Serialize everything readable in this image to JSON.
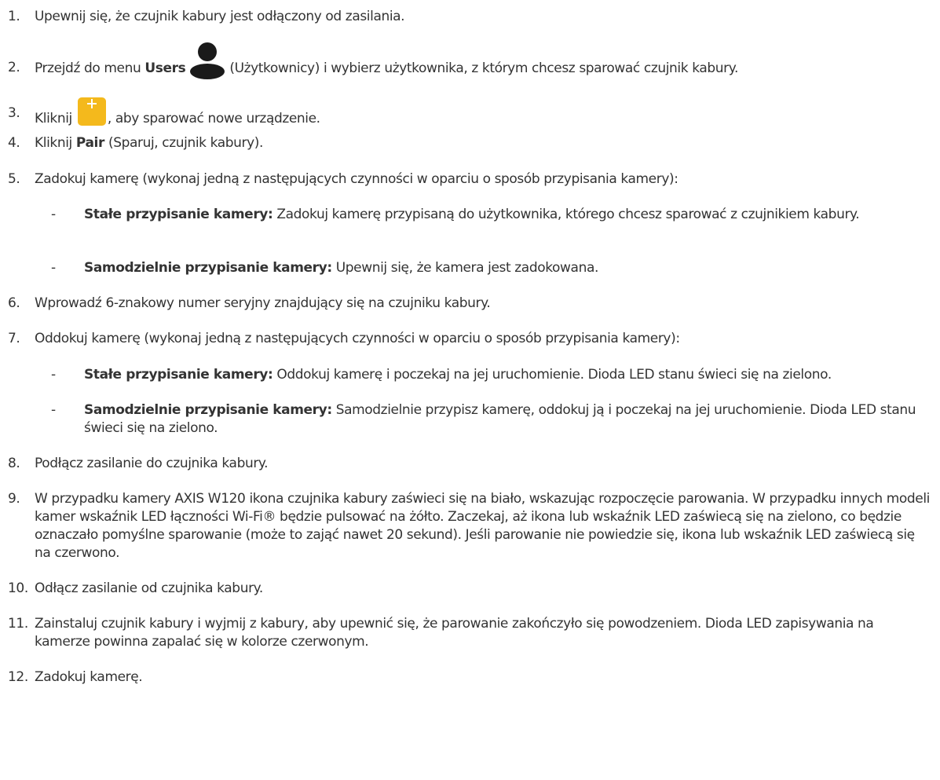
{
  "steps": [
    {
      "num": "1.",
      "text": "Upewnij się, że czujnik kabury jest odłączony od zasilania."
    },
    {
      "num": "2.",
      "pre": "Przejdź do menu ",
      "bold": "Users",
      "post": " (Użytkownicy) i wybierz użytkownika, z którym chcesz sparować czujnik kabury.",
      "icon": "user-icon"
    },
    {
      "num": "3.",
      "pre": "Kliknij ",
      "post": ", aby sparować nowe urządzenie.",
      "icon": "add-button-icon"
    },
    {
      "num": "4.",
      "pre": "Kliknij ",
      "bold": "Pair",
      "post": " (Sparuj, czujnik kabury)."
    },
    {
      "num": "5.",
      "text": "Zadokuj kamerę (wykonaj jedną z następujących czynności w oparciu o sposób przypisania kamery):",
      "subs": [
        {
          "dash": "-",
          "bold": "Stałe przypisanie kamery:",
          "text": " Zadokuj kamerę przypisaną do użytkownika, którego chcesz sparować z czujnikiem kabury."
        },
        {
          "dash": "-",
          "bold": "Samodzielnie przypisanie kamery:",
          "text": " Upewnij się, że kamera jest zadokowana."
        }
      ]
    },
    {
      "num": "6.",
      "text": "Wprowadź 6-znakowy numer seryjny znajdujący się na czujniku kabury."
    },
    {
      "num": "7.",
      "text": "Oddokuj kamerę (wykonaj jedną z następujących czynności w oparciu o sposób przypisania kamery):",
      "subs": [
        {
          "dash": "-",
          "bold": "Stałe przypisanie kamery:",
          "text": " Oddokuj kamerę i poczekaj na jej uruchomienie. Dioda LED stanu świeci się na zielono."
        },
        {
          "dash": "-",
          "bold": "Samodzielnie przypisanie kamery:",
          "text": " Samodzielnie przypisz kamerę, oddokuj ją i poczekaj na jej uruchomienie. Dioda LED stanu świeci się na zielono."
        }
      ]
    },
    {
      "num": "8.",
      "text": "Podłącz zasilanie do czujnika kabury."
    },
    {
      "num": "9.",
      "text": "W przypadku kamery AXIS W120 ikona czujnika kabury zaświeci się na biało, wskazując rozpoczęcie parowania. W przypadku innych modeli kamer wskaźnik LED łączności Wi-Fi® będzie pulsować na żółto. Zaczekaj, aż ikona lub wskaźnik LED zaświecą się na zielono, co będzie oznaczało pomyślne sparowanie (może to zająć nawet 20 sekund). Jeśli parowanie nie powiedzie się, ikona lub wskaźnik LED zaświecą się na czerwono."
    },
    {
      "num": "10.",
      "text": "Odłącz zasilanie od czujnika kabury."
    },
    {
      "num": "11.",
      "text": "Zainstaluj czujnik kabury i wyjmij z kabury, aby upewnić się, że parowanie zakończyło się powodzeniem. Dioda LED zapisywania na kamerze powinna zapalać się w kolorze czerwonym."
    },
    {
      "num": "12.",
      "text": "Zadokuj kamerę."
    }
  ],
  "colors": {
    "text": "#333333",
    "add_button": "#f4b91c",
    "icon": "#1a1a1a"
  }
}
